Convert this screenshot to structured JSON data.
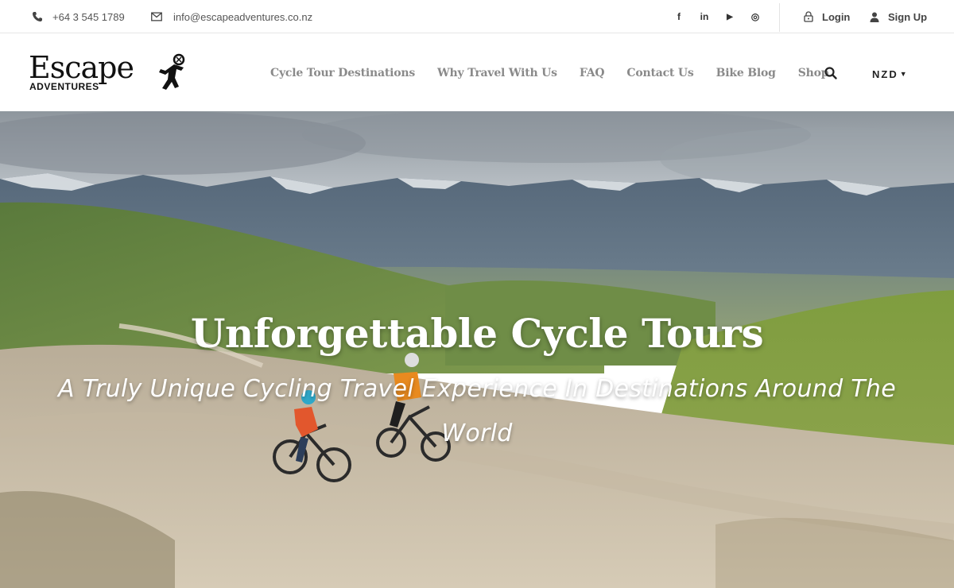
{
  "topbar": {
    "phone": "+64 3 545 1789",
    "email": "info@escapeadventures.co.nz",
    "social": [
      "facebook-icon",
      "linkedin-icon",
      "youtube-icon",
      "instagram-icon"
    ],
    "social_glyphs": [
      "f",
      "in",
      "▶",
      "◎"
    ],
    "login_label": "Login",
    "signup_label": "Sign Up"
  },
  "logo": {
    "word": "Escape",
    "sub": "ADVENTURES"
  },
  "nav": {
    "items": [
      {
        "label": "Cycle Tour Destinations"
      },
      {
        "label": "Why Travel With Us"
      },
      {
        "label": "FAQ"
      },
      {
        "label": "Contact Us"
      },
      {
        "label": "Bike Blog"
      },
      {
        "label": "Shop"
      }
    ],
    "currency": "NZD"
  },
  "hero": {
    "headline": "Unforgettable Cycle Tours",
    "tagline": "A Truly Unique Cycling Travel Experience In Destinations Around The World"
  },
  "colors": {
    "nav_text": "#8a8a8a",
    "text_dark": "#222222",
    "hero_text": "#ffffff"
  }
}
